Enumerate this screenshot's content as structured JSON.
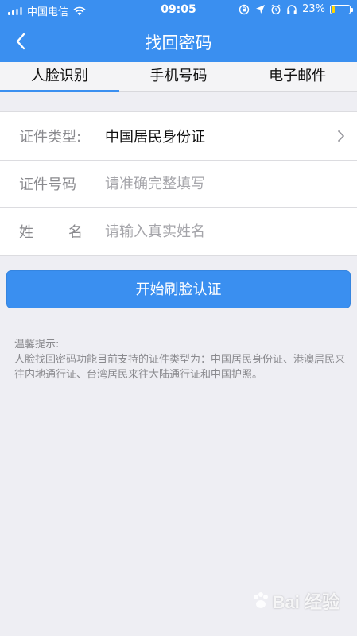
{
  "status_bar": {
    "carrier": "中国电信",
    "time": "09:05",
    "battery_percent": "23%",
    "battery_level": 0.23,
    "battery_color": "#ffd400",
    "icons": [
      "signal-icon",
      "wifi-icon",
      "rotation-lock-icon",
      "location-icon",
      "alarm-icon",
      "headphones-icon",
      "battery-icon"
    ]
  },
  "nav": {
    "title": "找回密码",
    "back_icon": "back-chevron-icon"
  },
  "tabs": [
    {
      "label": "人脸识别",
      "active": true
    },
    {
      "label": "手机号码",
      "active": false
    },
    {
      "label": "电子邮件",
      "active": false
    }
  ],
  "form": {
    "id_type": {
      "label": "证件类型:",
      "value": "中国居民身份证"
    },
    "id_number": {
      "label": "证件号码",
      "placeholder": "请准确完整填写"
    },
    "name": {
      "label_1": "姓",
      "label_2": "名",
      "placeholder": "请输入真实姓名"
    }
  },
  "primary_button": {
    "label": "开始刷脸认证"
  },
  "tips": {
    "title": "温馨提示:",
    "body": "人脸找回密码功能目前支持的证件类型为：中国居民身份证、港澳居民来往内地通行证、台湾居民来往大陆通行证和中国护照。"
  },
  "watermark": {
    "text": "Bai 经验"
  },
  "colors": {
    "accent": "#3a8ff0",
    "background": "#eeeef3"
  }
}
